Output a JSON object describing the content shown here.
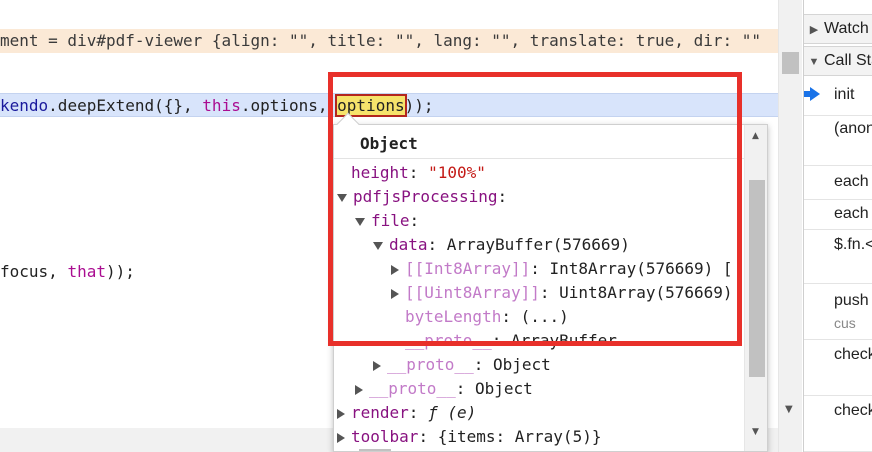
{
  "code": {
    "annotation_line": "ment = div#pdf-viewer {align: \"\", title: \"\", lang: \"\", translate: true, dir: \"\"",
    "active_line": {
      "part1": "kendo",
      "part2": ".deepExtend({}, ",
      "part3": "this",
      "part4": ".options, ",
      "part5": "options",
      "part6": "));"
    },
    "focus_line": {
      "part1": "focus, ",
      "part2": "that",
      "part3": "));"
    }
  },
  "right_panel": {
    "watch_label": "Watch",
    "call_stack_label": "Call Stack",
    "frames": [
      {
        "name": "init",
        "sub": ""
      },
      {
        "name": "(anonymous)",
        "sub": ""
      },
      {
        "name": "each",
        "sub": ""
      },
      {
        "name": "each",
        "sub": ""
      },
      {
        "name": "$.fn.<computed>",
        "sub": ""
      },
      {
        "name": "push",
        "sub": "cus"
      },
      {
        "name": "check",
        "sub": ""
      },
      {
        "name": "check",
        "sub": ""
      }
    ]
  },
  "popover": {
    "title": "Object",
    "rows": [
      {
        "key": "height",
        "sep": ": ",
        "value": "\"100%\"",
        "kind": "string"
      },
      {
        "key": "pdfjsProcessing",
        "sep": ":",
        "value": "",
        "kind": "expanded"
      },
      {
        "key": "file",
        "sep": ":",
        "value": "",
        "kind": "expanded"
      },
      {
        "key": "data",
        "sep": ": ",
        "value": "ArrayBuffer(576669)",
        "kind": "expanded"
      },
      {
        "key": "[[Int8Array]]",
        "sep": ": ",
        "value": "Int8Array(576669) [",
        "kind": "collapsed-internal"
      },
      {
        "key": "[[Uint8Array]]",
        "sep": ": ",
        "value": "Uint8Array(576669)",
        "kind": "collapsed-internal"
      },
      {
        "key": "byteLength",
        "sep": ": ",
        "value": "(...)",
        "kind": "internal"
      },
      {
        "key": "__proto__",
        "sep": ": ",
        "value": "ArrayBuffer",
        "kind": "internal-cut"
      },
      {
        "key": "__proto__",
        "sep": ": ",
        "value": "Object",
        "kind": "collapsed"
      },
      {
        "key": "__proto__",
        "sep": ": ",
        "value": "Object",
        "kind": "collapsed"
      },
      {
        "key": "render",
        "sep": ": ",
        "value_prefix": "ƒ",
        "value": "(e)",
        "kind": "function"
      },
      {
        "key": "toolbar",
        "sep": ": ",
        "value": "{items: Array(5)}",
        "kind": "collapsed"
      }
    ]
  },
  "colors": {
    "annotation_bg": "#fbe9d6",
    "active_line_bg": "#d8e4fb",
    "red_outline": "#e8302a",
    "property_key": "#881280",
    "string_value": "#c41a16"
  }
}
